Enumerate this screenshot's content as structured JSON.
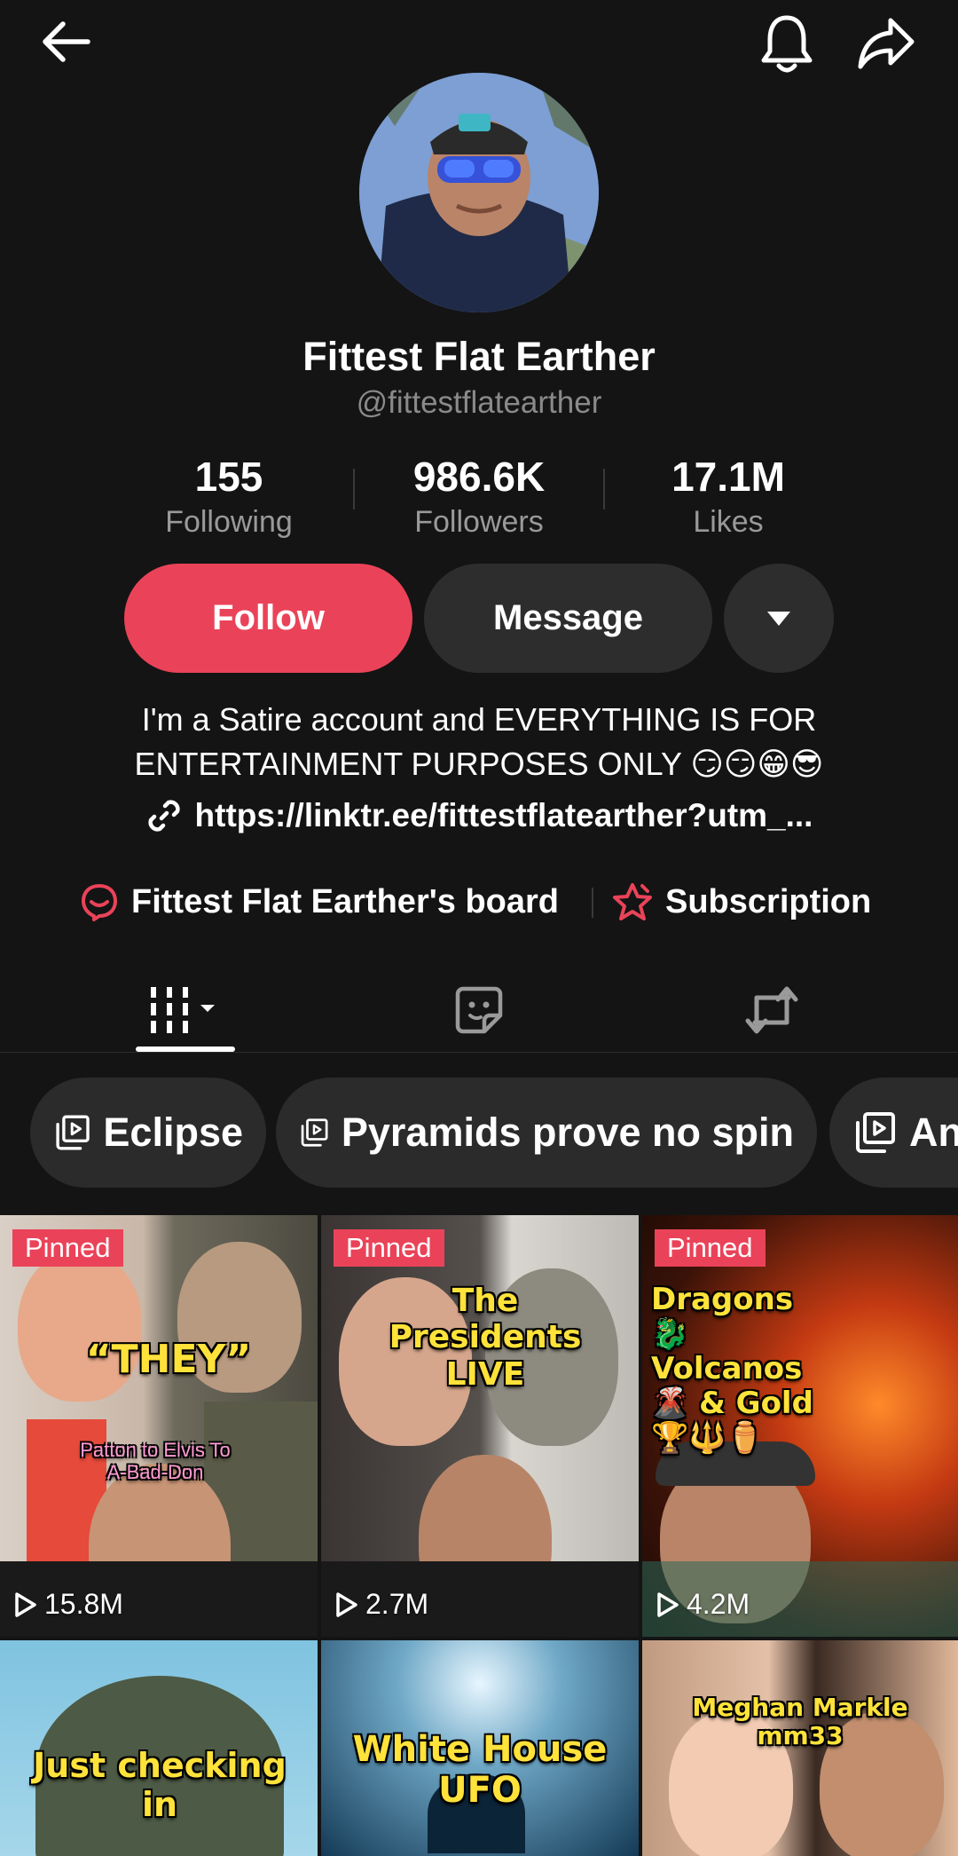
{
  "profile": {
    "display_name": "Fittest Flat Earther",
    "handle": "@fittestflatearther"
  },
  "stats": [
    {
      "value": "155",
      "label": "Following"
    },
    {
      "value": "986.6K",
      "label": "Followers"
    },
    {
      "value": "17.1M",
      "label": "Likes"
    }
  ],
  "actions": {
    "follow_label": "Follow",
    "message_label": "Message"
  },
  "bio": {
    "text": "I'm a Satire account and EVERYTHING IS FOR ENTERTAINMENT PURPOSES ONLY 😏😏😁😎",
    "link": "https://linktr.ee/fittestflatearther?utm_..."
  },
  "extras": {
    "board_label": "Fittest Flat Earther's board",
    "subscription_label": "Subscription"
  },
  "playlists": [
    {
      "label": "Eclipse"
    },
    {
      "label": "Pyramids prove no spin"
    },
    {
      "label": "An"
    }
  ],
  "videos": [
    {
      "pinned": "Pinned",
      "views": "15.8M",
      "caption": "“THEY”",
      "subcaption": "Patton to Elvis To A-Bad-Don"
    },
    {
      "pinned": "Pinned",
      "views": "2.7M",
      "caption": "The Presidents LIVE"
    },
    {
      "pinned": "Pinned",
      "views": "4.2M",
      "caption": "Dragons🐉 Volcanos🌋 & Gold🏆🔱⚱️"
    },
    {
      "caption": "Just checking in"
    },
    {
      "caption": "White House UFO"
    },
    {
      "caption": "Meghan Markle mm33"
    }
  ],
  "colors": {
    "background": "#141414",
    "accent": "#ea4359",
    "button_dark": "#2d2d2d",
    "caption_yellow": "#ffe23a"
  },
  "icons": [
    "back-arrow-icon",
    "bell-icon",
    "share-icon",
    "caret-down-icon",
    "link-icon",
    "board-icon",
    "subscription-star-icon",
    "videos-grid-icon",
    "favorites-sticker-icon",
    "reposts-icon",
    "playlist-icon",
    "play-icon"
  ]
}
